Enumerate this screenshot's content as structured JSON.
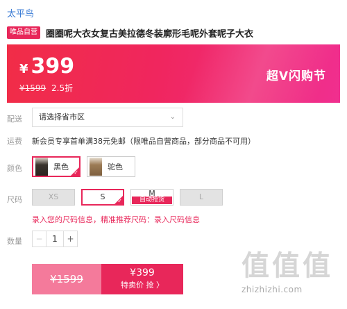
{
  "brand": "太平鸟",
  "product": {
    "badge": "唯品自营",
    "title": "圈圈呢大衣女复古美拉德冬装廓形毛呢外套呢子大衣"
  },
  "price": {
    "currency": "¥",
    "current": "399",
    "original": "¥1599",
    "discount": "2.5折",
    "promo": "超V闪购节"
  },
  "delivery": {
    "label": "配送",
    "placeholder": "请选择省市区"
  },
  "shipping": {
    "label": "运费",
    "note": "新会员专享首单满38元免邮（限唯品自营商品，部分商品不可用）"
  },
  "colors": {
    "label": "颜色",
    "options": [
      "黑色",
      "驼色"
    ],
    "selected": "黑色"
  },
  "sizes": {
    "label": "尺码",
    "options": [
      "XS",
      "S",
      "M",
      "L"
    ],
    "selected": "S",
    "m_tag": "自动抢货",
    "hint": "录入您的尺码信息，精准推荐尺码：录入尺码信息"
  },
  "quantity": {
    "label": "数量",
    "minus": "−",
    "value": "1",
    "plus": "+"
  },
  "buy": {
    "original_price": "¥1599",
    "sale_price": "¥399",
    "sale_label": "特卖价 抢 〉"
  },
  "watermark": {
    "glyphs": [
      "值",
      "值",
      "值"
    ],
    "url": "zhizhizhi.com"
  },
  "icons": {
    "region_chevron": "chevron-down-icon",
    "selected_tick": "checkmark-icon"
  },
  "colors_theme": {
    "accent": "#e8275a",
    "link": "#3a7bd5"
  }
}
